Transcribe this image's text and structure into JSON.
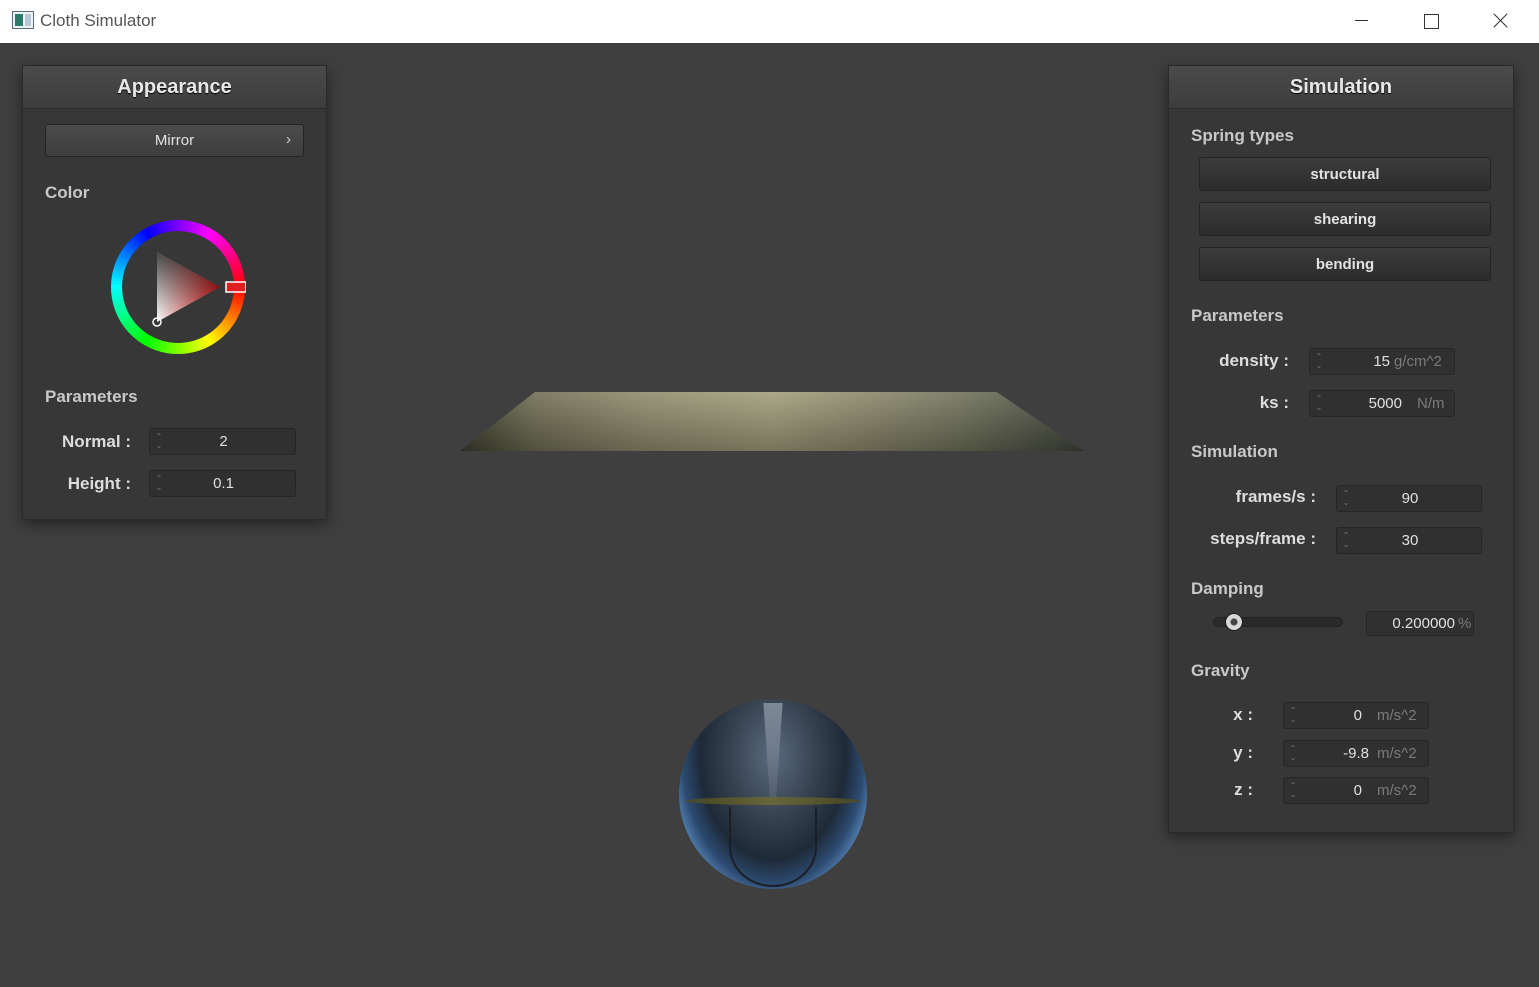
{
  "window": {
    "title": "Cloth Simulator"
  },
  "appearance": {
    "title": "Appearance",
    "shader": "Mirror",
    "color_label": "Color",
    "selected_color": "#e02020",
    "parameters_label": "Parameters",
    "normal_label": "Normal :",
    "normal_value": "2",
    "height_label": "Height :",
    "height_value": "0.1"
  },
  "simulation": {
    "title": "Simulation",
    "spring_types_label": "Spring types",
    "springs": {
      "structural": "structural",
      "shearing": "shearing",
      "bending": "bending"
    },
    "parameters_label": "Parameters",
    "density_label": "density :",
    "density_value": "15",
    "density_unit": "g/cm^2",
    "ks_label": "ks :",
    "ks_value": "5000",
    "ks_unit": "N/m",
    "sim_label": "Simulation",
    "fps_label": "frames/s :",
    "fps_value": "90",
    "steps_label": "steps/frame :",
    "steps_value": "30",
    "damping_label": "Damping",
    "damping_value": "0.200000",
    "damping_unit": "%",
    "damping_slider_fraction": 0.2,
    "gravity_label": "Gravity",
    "gx_label": "x :",
    "gx_value": "0",
    "gy_label": "y :",
    "gy_value": "-9.8",
    "gz_label": "z :",
    "gz_value": "0",
    "gravity_unit": "m/s^2"
  }
}
